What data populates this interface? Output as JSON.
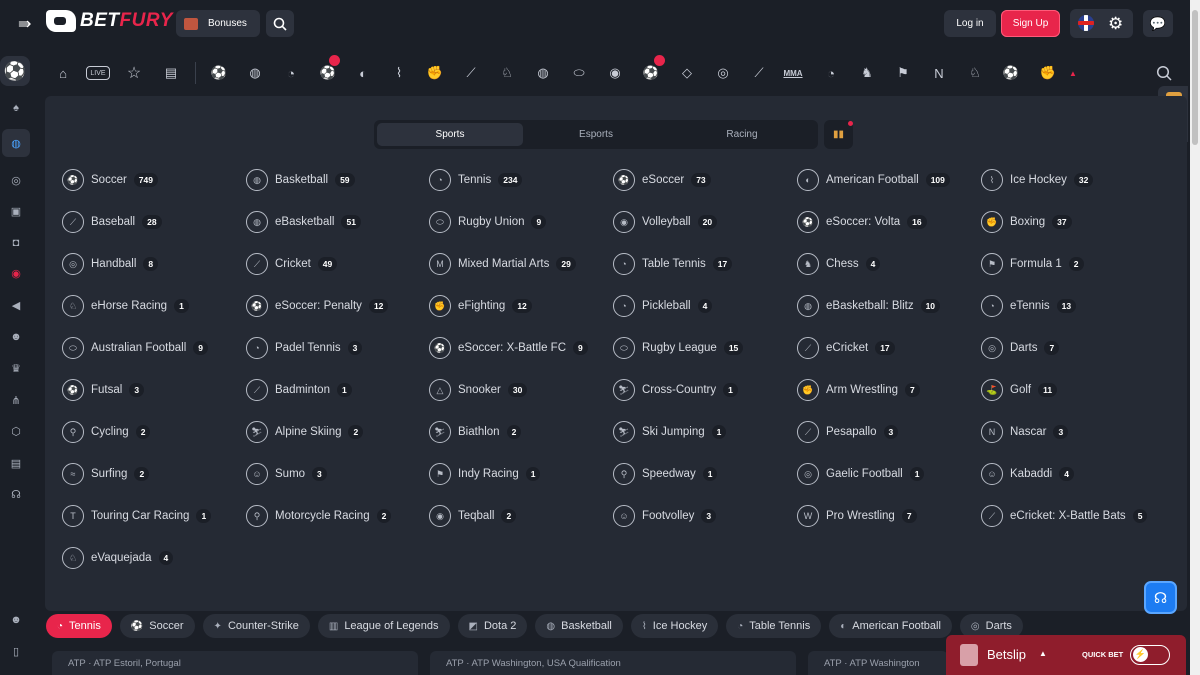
{
  "header": {
    "logo_text_a": "BET",
    "logo_text_b": "FURY",
    "bonuses_label": "Bonuses",
    "login_label": "Log in",
    "signup_label": "Sign Up"
  },
  "sportsbar": {
    "live_label": "LIVE",
    "mma_label": "MMA"
  },
  "tabs": [
    "Sports",
    "Esports",
    "Racing"
  ],
  "sports": [
    {
      "name": "Soccer",
      "count": "749",
      "icon": "⚽"
    },
    {
      "name": "Basketball",
      "count": "59",
      "icon": "◍"
    },
    {
      "name": "Tennis",
      "count": "234",
      "icon": "◔"
    },
    {
      "name": "eSoccer",
      "count": "73",
      "icon": "⚽"
    },
    {
      "name": "American Football",
      "count": "109",
      "icon": "◐"
    },
    {
      "name": "Ice Hockey",
      "count": "32",
      "icon": "⌇"
    },
    {
      "name": "Baseball",
      "count": "28",
      "icon": "⟋"
    },
    {
      "name": "eBasketball",
      "count": "51",
      "icon": "◍"
    },
    {
      "name": "Rugby Union",
      "count": "9",
      "icon": "⬭"
    },
    {
      "name": "Volleyball",
      "count": "20",
      "icon": "◉"
    },
    {
      "name": "eSoccer: Volta",
      "count": "16",
      "icon": "⚽"
    },
    {
      "name": "Boxing",
      "count": "37",
      "icon": "✊"
    },
    {
      "name": "Handball",
      "count": "8",
      "icon": "◎"
    },
    {
      "name": "Cricket",
      "count": "49",
      "icon": "⟋"
    },
    {
      "name": "Mixed Martial Arts",
      "count": "29",
      "icon": "M"
    },
    {
      "name": "Table Tennis",
      "count": "17",
      "icon": "◔"
    },
    {
      "name": "Chess",
      "count": "4",
      "icon": "♞"
    },
    {
      "name": "Formula 1",
      "count": "2",
      "icon": "⚑"
    },
    {
      "name": "eHorse Racing",
      "count": "1",
      "icon": "♘"
    },
    {
      "name": "eSoccer: Penalty",
      "count": "12",
      "icon": "⚽"
    },
    {
      "name": "eFighting",
      "count": "12",
      "icon": "✊"
    },
    {
      "name": "Pickleball",
      "count": "4",
      "icon": "◔"
    },
    {
      "name": "eBasketball: Blitz",
      "count": "10",
      "icon": "◍"
    },
    {
      "name": "eTennis",
      "count": "13",
      "icon": "◔"
    },
    {
      "name": "Australian Football",
      "count": "9",
      "icon": "⬭"
    },
    {
      "name": "Padel Tennis",
      "count": "3",
      "icon": "◔"
    },
    {
      "name": "eSoccer: X-Battle FC",
      "count": "9",
      "icon": "⚽"
    },
    {
      "name": "Rugby League",
      "count": "15",
      "icon": "⬭"
    },
    {
      "name": "eCricket",
      "count": "17",
      "icon": "⟋"
    },
    {
      "name": "Darts",
      "count": "7",
      "icon": "◎"
    },
    {
      "name": "Futsal",
      "count": "3",
      "icon": "⚽"
    },
    {
      "name": "Badminton",
      "count": "1",
      "icon": "⟋"
    },
    {
      "name": "Snooker",
      "count": "30",
      "icon": "△"
    },
    {
      "name": "Cross-Country",
      "count": "1",
      "icon": "⛷"
    },
    {
      "name": "Arm Wrestling",
      "count": "7",
      "icon": "✊"
    },
    {
      "name": "Golf",
      "count": "11",
      "icon": "⛳"
    },
    {
      "name": "Cycling",
      "count": "2",
      "icon": "⚲"
    },
    {
      "name": "Alpine Skiing",
      "count": "2",
      "icon": "⛷"
    },
    {
      "name": "Biathlon",
      "count": "2",
      "icon": "⛷"
    },
    {
      "name": "Ski Jumping",
      "count": "1",
      "icon": "⛷"
    },
    {
      "name": "Pesapallo",
      "count": "3",
      "icon": "⟋"
    },
    {
      "name": "Nascar",
      "count": "3",
      "icon": "N"
    },
    {
      "name": "Surfing",
      "count": "2",
      "icon": "≈"
    },
    {
      "name": "Sumo",
      "count": "3",
      "icon": "☺"
    },
    {
      "name": "Indy Racing",
      "count": "1",
      "icon": "⚑"
    },
    {
      "name": "Speedway",
      "count": "1",
      "icon": "⚲"
    },
    {
      "name": "Gaelic Football",
      "count": "1",
      "icon": "◎"
    },
    {
      "name": "Kabaddi",
      "count": "4",
      "icon": "☺"
    },
    {
      "name": "Touring Car Racing",
      "count": "1",
      "icon": "T"
    },
    {
      "name": "Motorcycle Racing",
      "count": "2",
      "icon": "⚲"
    },
    {
      "name": "Teqball",
      "count": "2",
      "icon": "◉"
    },
    {
      "name": "Footvolley",
      "count": "3",
      "icon": "☺"
    },
    {
      "name": "Pro Wrestling",
      "count": "7",
      "icon": "W"
    },
    {
      "name": "eCricket: X-Battle Bats",
      "count": "5",
      "icon": "⟋"
    },
    {
      "name": "eVaquejada",
      "count": "4",
      "icon": "♘"
    }
  ],
  "bottom_tabs": [
    {
      "label": "Tennis",
      "icon": "◔"
    },
    {
      "label": "Soccer",
      "icon": "⚽"
    },
    {
      "label": "Counter-Strike",
      "icon": "✦"
    },
    {
      "label": "League of Legends",
      "icon": "▥"
    },
    {
      "label": "Dota 2",
      "icon": "◩"
    },
    {
      "label": "Basketball",
      "icon": "◍"
    },
    {
      "label": "Ice Hockey",
      "icon": "⌇"
    },
    {
      "label": "Table Tennis",
      "icon": "◔"
    },
    {
      "label": "American Football",
      "icon": "◐"
    },
    {
      "label": "Darts",
      "icon": "◎"
    }
  ],
  "matches": [
    "ATP · ATP Estoril, Portugal",
    "ATP · ATP Washington, USA Qualification",
    "ATP · ATP Washington"
  ],
  "betslip": {
    "label": "Betslip",
    "quick_bet_label": "QUICK BET"
  },
  "colors": {
    "accent": "#e8254b",
    "background": "#1b1f27",
    "panel": "#252a34",
    "support": "#1d7cf2"
  }
}
